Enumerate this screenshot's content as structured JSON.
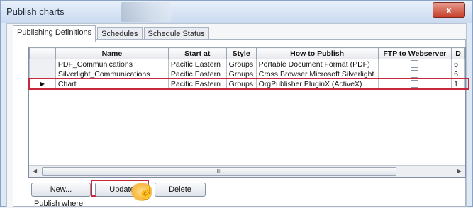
{
  "window": {
    "title": "Publish charts",
    "close_label": "x"
  },
  "tabs": [
    {
      "label": "Publishing Definitions",
      "active": true
    },
    {
      "label": "Schedules",
      "active": false
    },
    {
      "label": "Schedule Status",
      "active": false
    }
  ],
  "grid": {
    "columns": [
      "",
      "Name",
      "Start at",
      "Style",
      "How to Publish",
      "FTP to Webserver",
      "D"
    ],
    "rows": [
      {
        "indicator": "",
        "name": "PDF_Communications",
        "start_at": "Pacific Eastern",
        "style": "Groups",
        "how": "Portable Document Format (PDF)",
        "ftp": false,
        "d": "6"
      },
      {
        "indicator": "",
        "name": "Silverlight_Communications",
        "start_at": "Pacific Eastern",
        "style": "Groups",
        "how": "Cross Browser Microsoft Silverlight",
        "ftp": false,
        "d": "6"
      },
      {
        "indicator": "▶",
        "name": "Chart",
        "start_at": "Pacific Eastern",
        "style": "Groups",
        "how": "OrgPublisher PluginX  (ActiveX)",
        "ftp": false,
        "d": "1"
      }
    ],
    "selected_row": 2
  },
  "scrollbar": {
    "grip": "III"
  },
  "buttons": {
    "new_label": "New...",
    "update_label": "Update",
    "delete_label": "Delete"
  },
  "footer": {
    "publish_where_label": "Publish where"
  },
  "colors": {
    "highlight": "#c8283c",
    "close_button": "#c6412b"
  }
}
